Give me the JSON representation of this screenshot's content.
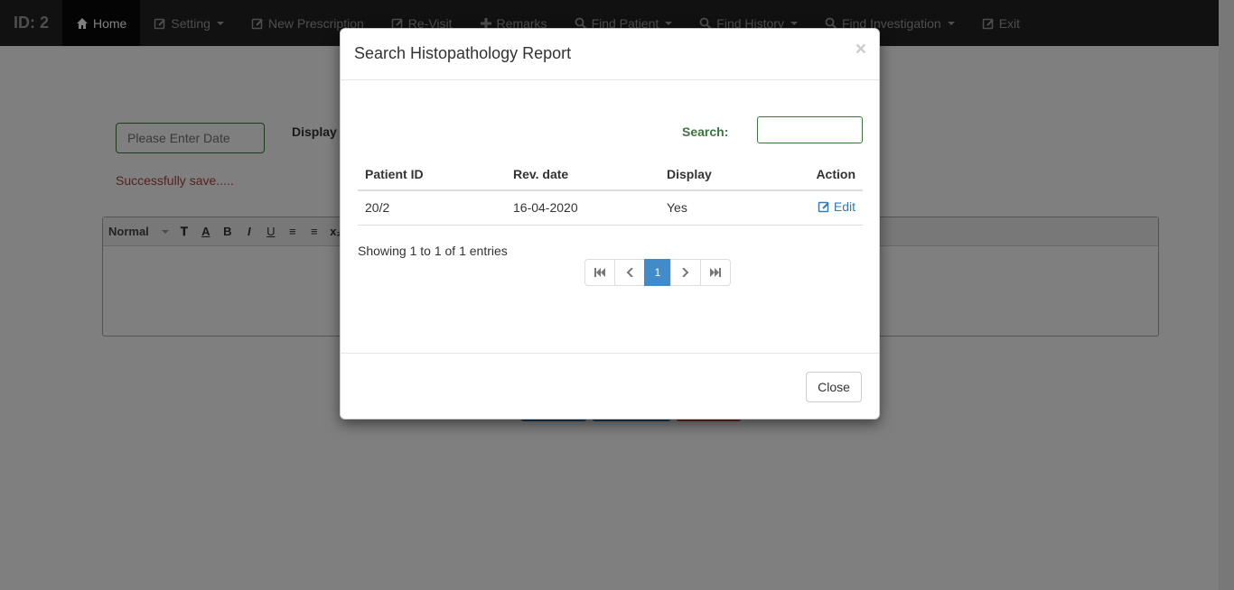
{
  "navbar": {
    "brand": "ID: 2",
    "items": [
      {
        "label": "Home",
        "icon": "home-icon",
        "active": true
      },
      {
        "label": "Setting",
        "icon": "edit-icon",
        "dropdown": true
      },
      {
        "label": "New Prescription",
        "icon": "edit-icon"
      },
      {
        "label": "Re-Visit",
        "icon": "edit-icon"
      },
      {
        "label": "Remarks",
        "icon": "plus-icon"
      },
      {
        "label": "Find Patient",
        "icon": "search-icon",
        "dropdown": true
      },
      {
        "label": "Find History",
        "icon": "search-icon",
        "dropdown": true
      },
      {
        "label": "Find Investigation",
        "icon": "search-icon",
        "dropdown": true
      },
      {
        "label": "Exit",
        "icon": "edit-icon"
      }
    ]
  },
  "page": {
    "date_placeholder": "Please Enter Date",
    "display_label": "Display",
    "success_message": "Successfully save.....",
    "editor": {
      "format_select": "Normal"
    }
  },
  "modal": {
    "title": "Search Histopathology Report",
    "close_symbol": "×",
    "search_label": "Search:",
    "search_value": "",
    "table": {
      "headers": [
        "Patient ID",
        "Rev. date",
        "Display",
        "Action"
      ],
      "rows": [
        {
          "patient_id": "20/2",
          "rev_date": "16-04-2020",
          "display": "Yes",
          "action": "Edit"
        }
      ]
    },
    "info": "Showing 1 to 1 of 1 entries",
    "pagination": {
      "current_page": "1"
    },
    "footer_close": "Close"
  },
  "colors": {
    "navbar_bg": "#222222",
    "success_text": "#a94442",
    "search_label": "#3c763d",
    "link": "#337ab7",
    "page_active": "#428bca"
  }
}
